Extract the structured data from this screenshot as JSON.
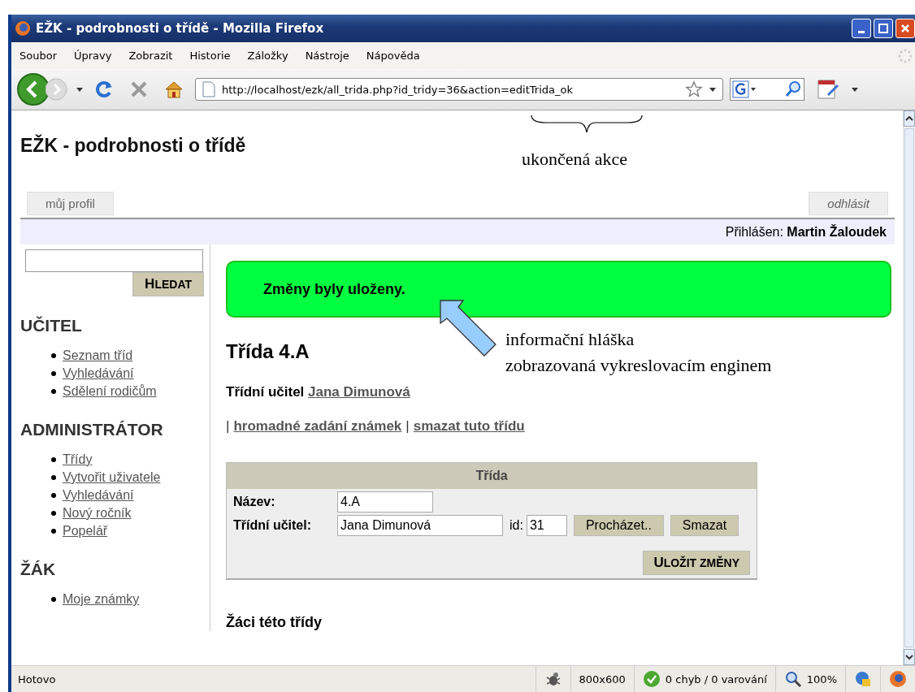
{
  "window": {
    "title": "EŽK - podrobnosti o třídě - Mozilla Firefox"
  },
  "menu": [
    {
      "label": "Soubor"
    },
    {
      "label": "Úpravy"
    },
    {
      "label": "Zobrazit"
    },
    {
      "label": "Historie"
    },
    {
      "label": "Záložky"
    },
    {
      "label": "Nástroje"
    },
    {
      "label": "Nápověda"
    }
  ],
  "address_bar": {
    "value": "http://localhost/ezk/all_trida.php?id_tridy=36&action=editTrida_ok"
  },
  "page": {
    "title": "EŽK - podrobnosti o třídě",
    "tabs": [
      {
        "label": "můj profil",
        "kind": "profile"
      },
      {
        "label": "odhlásit",
        "kind": "logout"
      }
    ],
    "login_label": "Přihlášen:",
    "user": "Martin Žaloudek",
    "sidebar": {
      "search_button": "HLEDAT",
      "sections": [
        {
          "heading": "UČITEL",
          "links": [
            "Seznam tříd",
            "Vyhledávání",
            "Sdělení rodičům"
          ]
        },
        {
          "heading": "ADMINISTRÁTOR",
          "links": [
            "Třídy",
            "Vytvořit uživatele",
            "Vyhledávání",
            "Nový ročník",
            "Popelář"
          ]
        },
        {
          "heading": "ŽÁK",
          "links": [
            "Moje známky"
          ]
        }
      ]
    },
    "message": "Změny byly uloženy.",
    "class_title": "Třída 4.A",
    "teacher_label": "Třídní učitel",
    "teacher_link": "Jana Dimunová",
    "action_separator": "|",
    "actions": [
      "hromadné zadání známek",
      "smazat tuto třídu"
    ],
    "form": {
      "title": "Třída",
      "name_label": "Název:",
      "name_value": "4.A",
      "teacher_label": "Třídní učitel:",
      "teacher_value": "Jana Dimunová",
      "id_label": "id:",
      "id_value": "31",
      "buttons": [
        "Procházet..",
        "Smazat"
      ],
      "save_button": "ULOŽIT ZMĚNY"
    },
    "students_heading": "Žáci této třídy"
  },
  "annotations": [
    {
      "kind": "brace",
      "text": "ukončená akce"
    },
    {
      "kind": "arrow",
      "text": "informační hláška\nzobrazovaná vykreslovacím enginem"
    }
  ],
  "status_bar": {
    "status": "Hotovo",
    "size": "800x600",
    "validation": "0 chyb / 0 varování",
    "zoom": "100%"
  }
}
